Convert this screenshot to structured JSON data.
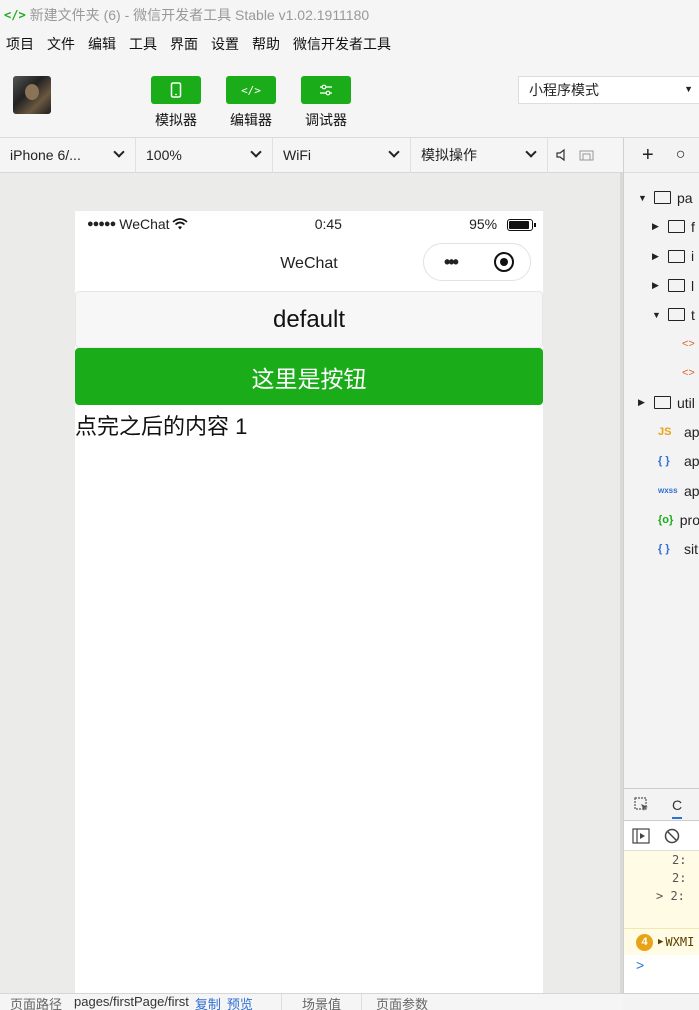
{
  "window": {
    "title": "新建文件夹 (6) - 微信开发者工具 Stable v1.02.1911180",
    "logo": "</>"
  },
  "menu": [
    "项目",
    "文件",
    "编辑",
    "工具",
    "界面",
    "设置",
    "帮助",
    "微信开发者工具"
  ],
  "toolbar": {
    "simulator_label": "模拟器",
    "editor_label": "编辑器",
    "debugger_label": "调试器",
    "editor_glyph": "</>",
    "mode": "小程序模式"
  },
  "controls": {
    "device": "iPhone 6/...",
    "zoom": "100%",
    "network": "WiFi",
    "operation": "模拟操作"
  },
  "phone": {
    "carrier": "WeChat",
    "time": "0:45",
    "battery": "95%",
    "nav_title": "WeChat",
    "default_button": "default",
    "primary_button": "这里是按钮",
    "content_text": "点完之后的内容 1"
  },
  "tree": {
    "rows": [
      {
        "label": "pa",
        "icon": "folder-open-icon",
        "expanded": true
      },
      {
        "label": "f",
        "icon": "folder-icon"
      },
      {
        "label": "i",
        "icon": "folder-icon"
      },
      {
        "label": "l",
        "icon": "folder-icon"
      },
      {
        "label": "t",
        "icon": "folder-open-icon",
        "expanded": true
      },
      {
        "label": "<>",
        "icon": "wxml-icon"
      },
      {
        "label": "<>",
        "icon": "wxml-icon"
      },
      {
        "label": "util",
        "icon": "folder-icon"
      },
      {
        "label": "JS",
        "name": "ap",
        "icon": "js-icon"
      },
      {
        "label": "{ }",
        "name": "ap",
        "icon": "json-icon"
      },
      {
        "label": "wxss",
        "name": "ap",
        "icon": "wxss-icon"
      },
      {
        "label": "{o}",
        "name": "pro",
        "icon": "config-icon"
      },
      {
        "label": "{ }",
        "name": "sit",
        "icon": "json-icon"
      }
    ]
  },
  "console": {
    "tab": "C",
    "log_lines": [
      "2:",
      "2:",
      "> 2:"
    ],
    "warn_count": "4",
    "warn_text": "WXMI",
    "prompt": ">"
  },
  "bottom": {
    "path_label": "页面路径",
    "path": "pages/firstPage/first",
    "copy": "复制",
    "preview": "预览",
    "scene": "场景值",
    "params": "页面参数"
  },
  "colors": {
    "accent": "#1aad19",
    "link": "#2f6fd6",
    "warn": "#e8a317"
  }
}
